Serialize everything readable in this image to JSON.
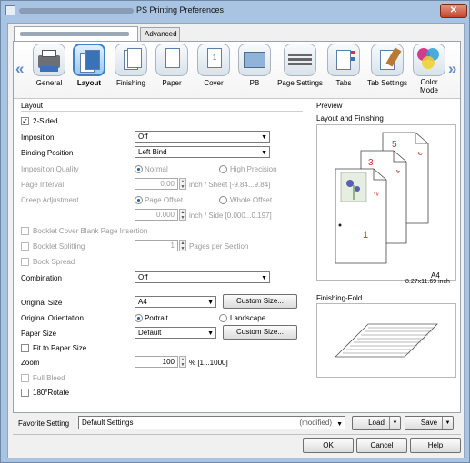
{
  "window": {
    "title": "PS Printing Preferences",
    "close_label": "✕"
  },
  "tabs": [
    {
      "label": ""
    },
    {
      "label": "Advanced"
    }
  ],
  "ribbon": {
    "items": [
      {
        "label": "General"
      },
      {
        "label": "Layout"
      },
      {
        "label": "Finishing"
      },
      {
        "label": "Paper"
      },
      {
        "label": "Cover"
      },
      {
        "label": "PB"
      },
      {
        "label": "Page Settings"
      },
      {
        "label": "Tabs"
      },
      {
        "label": "Tab Settings"
      },
      {
        "label": "Color Mode"
      }
    ]
  },
  "layout": {
    "group_label": "Layout",
    "two_sided": {
      "label": "2-Sided",
      "checked": true
    },
    "imposition": {
      "label": "Imposition",
      "value": "Off"
    },
    "binding_position": {
      "label": "Binding Position",
      "value": "Left Bind"
    },
    "imposition_quality": {
      "label": "Imposition Quality",
      "opt1": "Normal",
      "opt2": "High Precision"
    },
    "page_interval": {
      "label": "Page Interval",
      "value": "0.00",
      "unit": "inch / Sheet [-9.84...9.84]"
    },
    "creep_adjustment": {
      "label": "Creep Adjustment",
      "opt1": "Page Offset",
      "opt2": "Whole Offset",
      "value": "0.000",
      "unit": "inch / Side [0.000...0.197]"
    },
    "booklet_cover_blank": {
      "label": "Booklet Cover Blank Page Insertion"
    },
    "booklet_splitting": {
      "label": "Booklet Splitting",
      "value": "1",
      "unit": "Pages per Section"
    },
    "book_spread": {
      "label": "Book Spread"
    },
    "combination": {
      "label": "Combination",
      "value": "Off"
    },
    "original_size": {
      "label": "Original Size",
      "value": "A4",
      "button": "Custom Size..."
    },
    "original_orientation": {
      "label": "Original Orientation",
      "opt1": "Portrait",
      "opt2": "Landscape"
    },
    "paper_size": {
      "label": "Paper Size",
      "value": "Default",
      "button": "Custom Size..."
    },
    "fit_to_paper": {
      "label": "Fit to Paper Size"
    },
    "zoom": {
      "label": "Zoom",
      "value": "100",
      "unit": "% [1...1000]"
    },
    "full_bleed": {
      "label": "Full Bleed"
    },
    "rotate180": {
      "label": "180°Rotate"
    }
  },
  "preview": {
    "group_label": "Preview",
    "layout_label": "Layout and Finishing",
    "paper_label": "A4",
    "paper_dims": "8.27x11.69 inch",
    "fold_label": "Finishing-Fold",
    "page_numbers": [
      "1",
      "2",
      "3",
      "4",
      "5",
      "6"
    ]
  },
  "favorite": {
    "label": "Favorite Setting",
    "value": "Default Settings",
    "modified": "(modified)",
    "load": "Load",
    "save": "Save"
  },
  "buttons": {
    "ok": "OK",
    "cancel": "Cancel",
    "help": "Help"
  }
}
